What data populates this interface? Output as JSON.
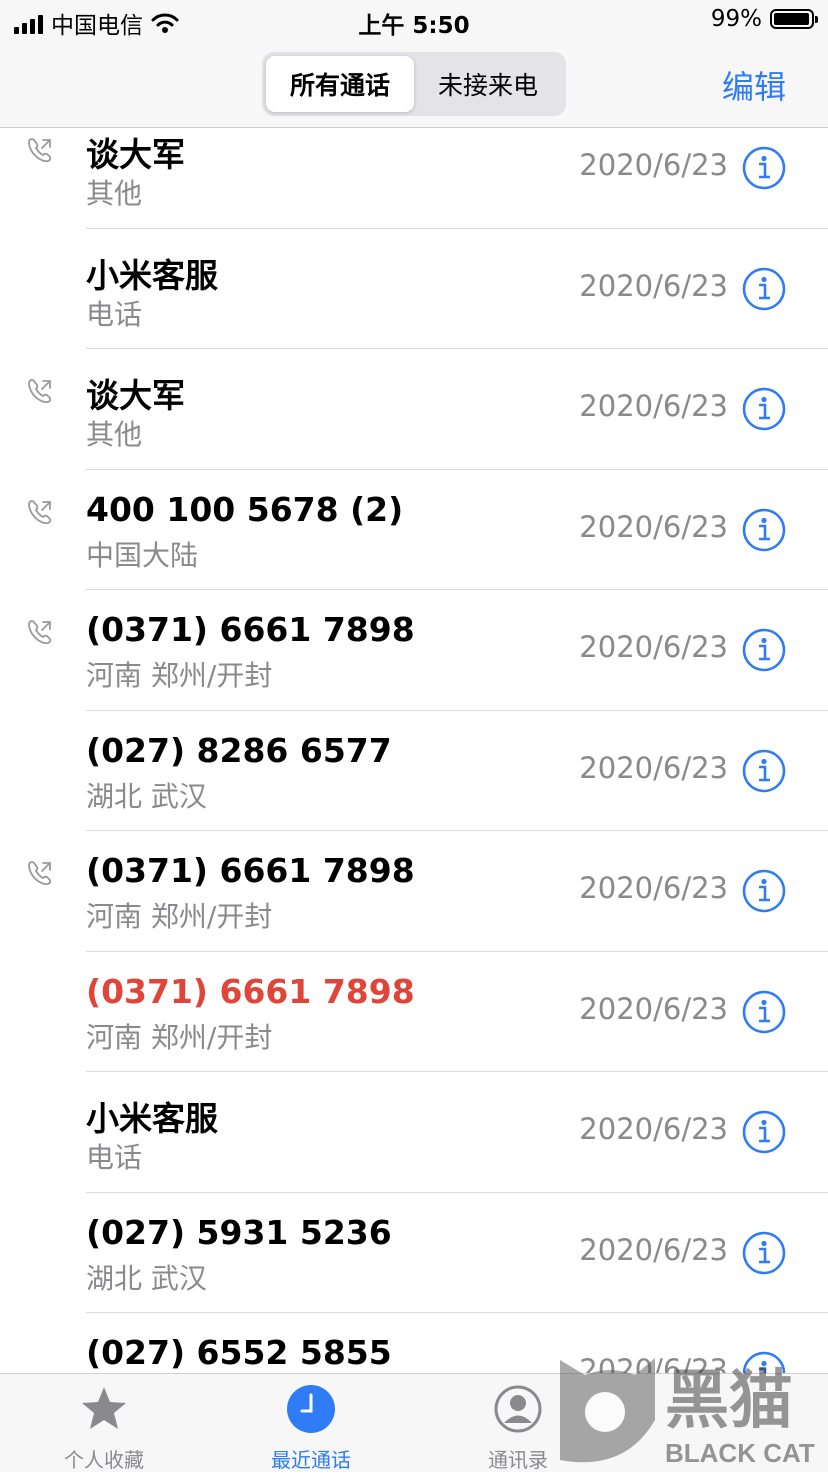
{
  "status": {
    "carrier": "中国电信",
    "time": "上午 5:50",
    "battery": "99%"
  },
  "nav": {
    "segments": [
      "所有通话",
      "未接来电"
    ],
    "active_segment": 0,
    "edit": "编辑"
  },
  "calls": [
    {
      "name": "谈大军",
      "sub": "其他",
      "date": "2020/6/23",
      "outgoing": true,
      "missed": false
    },
    {
      "name": "小米客服",
      "sub": "电话",
      "date": "2020/6/23",
      "outgoing": false,
      "missed": false
    },
    {
      "name": "谈大军",
      "sub": "其他",
      "date": "2020/6/23",
      "outgoing": true,
      "missed": false
    },
    {
      "name": "400 100 5678 (2)",
      "sub": "中国大陆",
      "date": "2020/6/23",
      "outgoing": true,
      "missed": false
    },
    {
      "name": "(0371) 6661 7898",
      "sub": "河南 郑州/开封",
      "date": "2020/6/23",
      "outgoing": true,
      "missed": false
    },
    {
      "name": "(027) 8286 6577",
      "sub": "湖北 武汉",
      "date": "2020/6/23",
      "outgoing": false,
      "missed": false
    },
    {
      "name": "(0371) 6661 7898",
      "sub": "河南 郑州/开封",
      "date": "2020/6/23",
      "outgoing": true,
      "missed": false
    },
    {
      "name": "(0371) 6661 7898",
      "sub": "河南 郑州/开封",
      "date": "2020/6/23",
      "outgoing": false,
      "missed": true
    },
    {
      "name": "小米客服",
      "sub": "电话",
      "date": "2020/6/23",
      "outgoing": false,
      "missed": false
    },
    {
      "name": "(027) 5931 5236",
      "sub": "湖北 武汉",
      "date": "2020/6/23",
      "outgoing": false,
      "missed": false
    },
    {
      "name": "(027) 6552 5855",
      "sub": "",
      "date": "2020/6/23",
      "outgoing": false,
      "missed": false
    }
  ],
  "tabs": [
    {
      "label": "个人收藏",
      "icon": "star-icon",
      "active": false
    },
    {
      "label": "最近通话",
      "icon": "clock-icon",
      "active": true
    },
    {
      "label": "通讯录",
      "icon": "contacts-icon",
      "active": false
    }
  ],
  "watermark": {
    "text": "BLACK CAT",
    "cn": "黑猫"
  },
  "colors": {
    "accent": "#2f7cf6",
    "missed": "#e0453a",
    "secondary": "#8a8a8e"
  }
}
